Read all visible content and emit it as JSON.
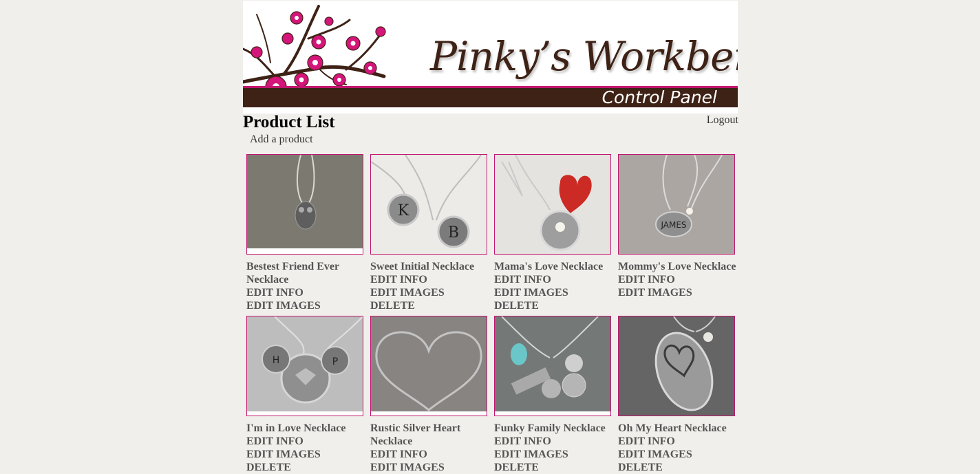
{
  "banner": {
    "brand": "Pinky’s Workbench",
    "subtitle": "Control Panel",
    "accent_color": "#c2166f",
    "bar_color": "#3e2216"
  },
  "page": {
    "title": "Product List",
    "logout_label": "Logout",
    "add_product_label": "Add a product"
  },
  "products": [
    {
      "name": "Bestest Friend Ever Necklace",
      "actions": [
        "EDIT INFO",
        "EDIT IMAGES"
      ],
      "image": "owl-pendant-necklace",
      "bg": "#7c7a70"
    },
    {
      "name": "Sweet Initial Necklace",
      "actions": [
        "EDIT INFO",
        "EDIT IMAGES",
        "DELETE"
      ],
      "image": "initial-discs-necklace",
      "bg": "#ecebe7"
    },
    {
      "name": "Mama's Love Necklace",
      "actions": [
        "EDIT INFO",
        "EDIT IMAGES",
        "DELETE"
      ],
      "image": "red-heart-necklace",
      "bg": "#e4e3e0"
    },
    {
      "name": "Mommy's Love Necklace",
      "actions": [
        "EDIT INFO",
        "EDIT IMAGES"
      ],
      "image": "james-disc-necklace",
      "bg": "#aba6a1"
    },
    {
      "name": "I'm in Love Necklace",
      "actions": [
        "EDIT INFO",
        "EDIT IMAGES",
        "DELETE"
      ],
      "image": "stacked-discs-necklace",
      "bg": "#bdbdbd"
    },
    {
      "name": "Rustic Silver Heart Necklace",
      "actions": [
        "EDIT INFO",
        "EDIT IMAGES"
      ],
      "image": "wire-heart-necklace",
      "bg": "#888482"
    },
    {
      "name": "Funky Family Necklace",
      "actions": [
        "EDIT INFO",
        "EDIT IMAGES",
        "DELETE"
      ],
      "image": "family-charms-necklace",
      "bg": "#747876"
    },
    {
      "name": "Oh My Heart Necklace",
      "actions": [
        "EDIT INFO",
        "EDIT IMAGES",
        "DELETE"
      ],
      "image": "oval-heart-necklace",
      "bg": "#656565"
    }
  ]
}
